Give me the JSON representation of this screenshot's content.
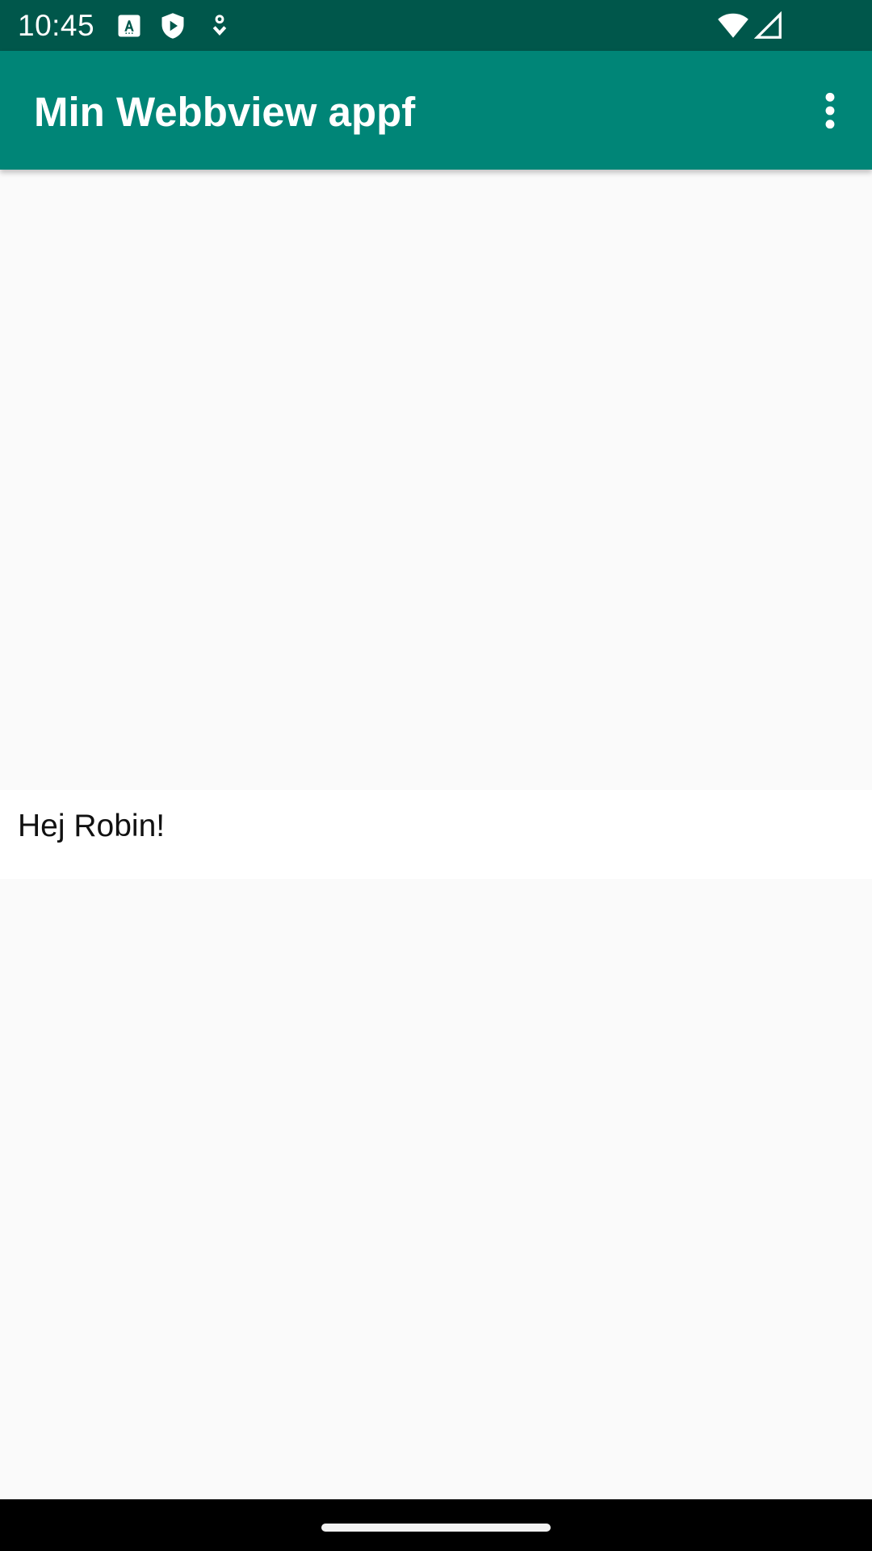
{
  "status_bar": {
    "time": "10:45",
    "left_icons": [
      "font-a-icon",
      "shield-play-icon",
      "location-pin-icon"
    ],
    "right_icons": [
      "wifi-icon",
      "cell-signal-icon"
    ],
    "background": "#00574b"
  },
  "app_bar": {
    "title": "Min Webbview appf",
    "overflow_icon": "more-vert-icon",
    "background": "#008577"
  },
  "webview": {
    "text": "Hej Robin!"
  },
  "nav_bar": {
    "background": "#000000",
    "home_handle_color": "#f2f2f2"
  }
}
